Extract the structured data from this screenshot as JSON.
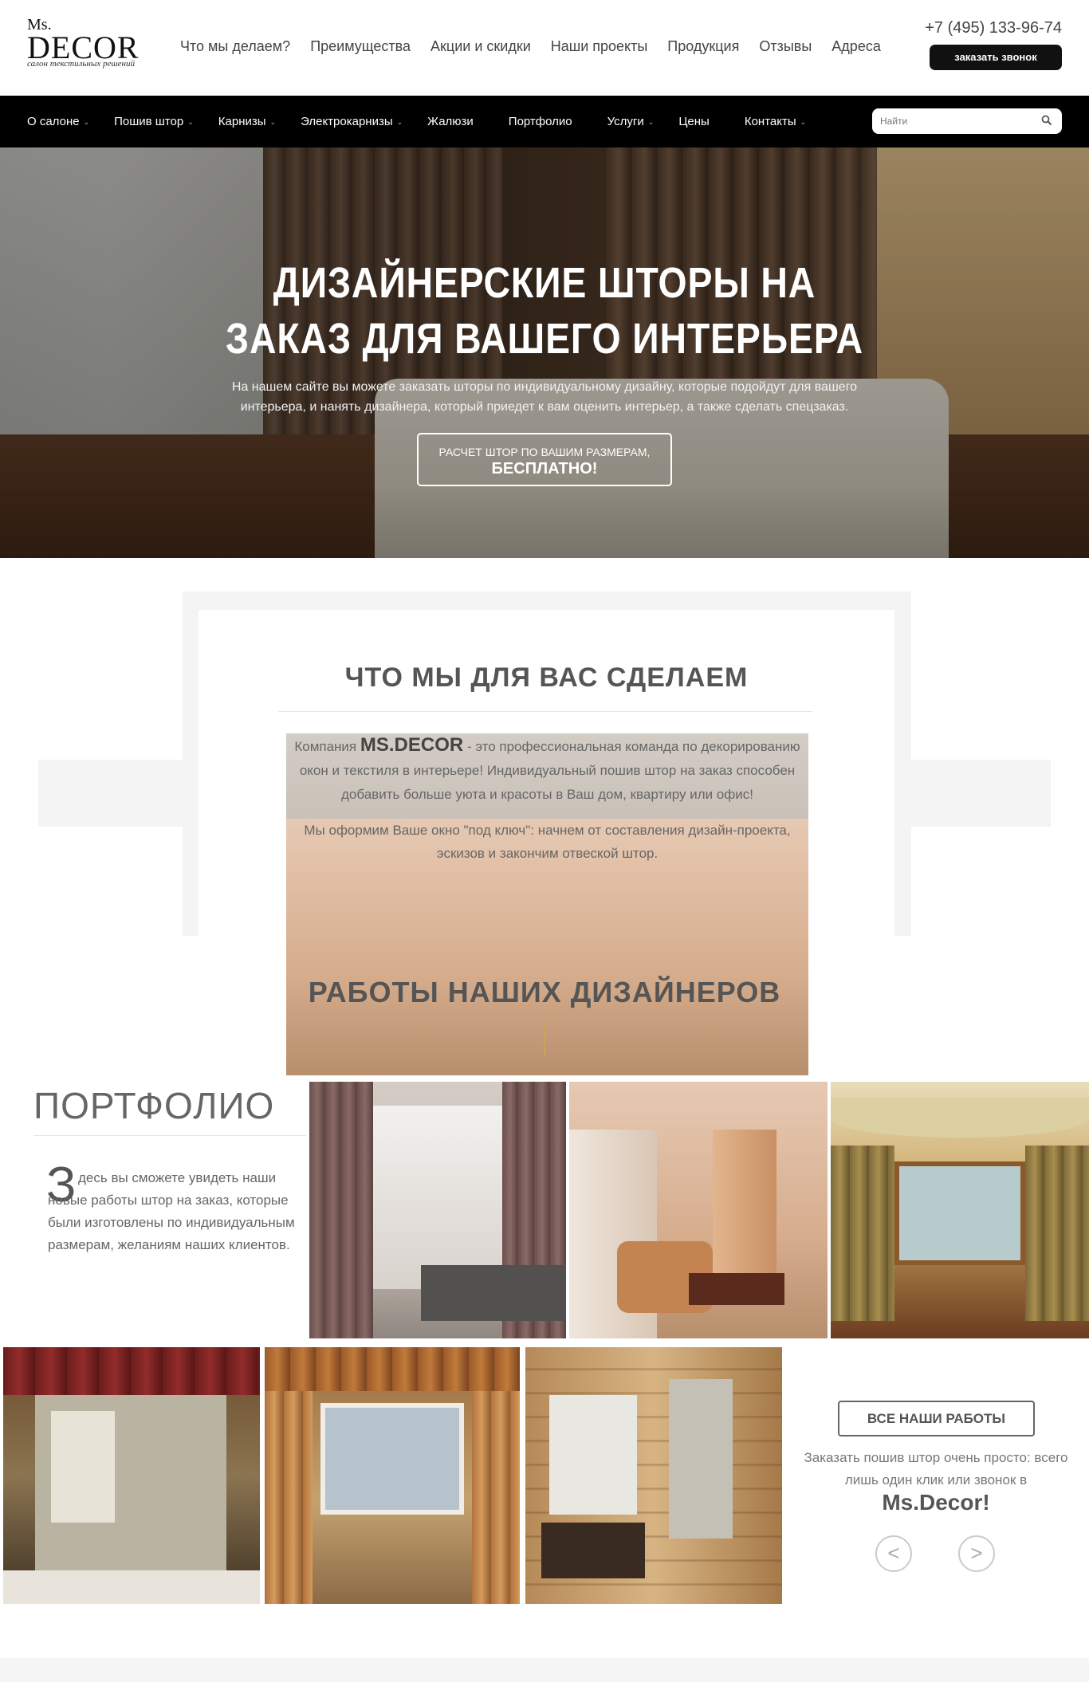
{
  "logo": {
    "ms": "Ms.",
    "decor": "DECOR",
    "tagline": "салон текстильных решений"
  },
  "top_nav": [
    "Что мы делаем?",
    "Преимущества",
    "Акции и скидки",
    "Наши проекты",
    "Продукция",
    "Отзывы",
    "Адреса"
  ],
  "contact": {
    "phone": "+7 (495) 133-96-74",
    "call_button": "заказать звонок"
  },
  "main_nav": [
    {
      "label": "О салоне",
      "dropdown": true
    },
    {
      "label": "Пошив штор",
      "dropdown": true
    },
    {
      "label": "Карнизы",
      "dropdown": true
    },
    {
      "label": "Электрокарнизы",
      "dropdown": true
    },
    {
      "label": "Жалюзи",
      "dropdown": false
    },
    {
      "label": "Портфолио",
      "dropdown": false
    },
    {
      "label": "Услуги",
      "dropdown": true
    },
    {
      "label": "Цены",
      "dropdown": false
    },
    {
      "label": "Контакты",
      "dropdown": true
    }
  ],
  "search": {
    "placeholder": "Найти"
  },
  "hero": {
    "title_line1": "ДИЗАЙНЕРСКИЕ ШТОРЫ НА",
    "title_line2": "ЗАКАЗ ДЛЯ ВАШЕГО ИНТЕРЬЕРА",
    "subtitle": "На нашем сайте вы можете заказать шторы по индивидуальному дизайну, которые подойдут для вашего интерьера, и нанять дизайнера, который приедет к вам оценить интерьер, а также сделать спецзаказ.",
    "cta_line1": "РАСЧЕТ ШТОР ПО ВАШИМ РАЗМЕРАМ,",
    "cta_line2": "БЕСПЛАТНО!"
  },
  "what": {
    "title": "ЧТО МЫ ДЛЯ ВАС СДЕЛАЕМ",
    "p1_prefix": "Компания ",
    "p1_brand": "MS.DECOR",
    "p1_rest": " - это профессиональная команда по декорированию окон и текстиля в интерьере! Индивидуальный пошив штор на заказ способен добавить больше уюта и красоты в Ваш дом, квартиру или офис!",
    "p2": "Мы оформим Ваше окно \"под ключ\": начнем от составления дизайн-проекта, эскизов и закончим отвеской штор."
  },
  "works": {
    "title": "РАБОТЫ НАШИХ ДИЗАЙНЕРОВ",
    "portfolio_title": "ПОРТФОЛИО",
    "dropcap": "З",
    "portfolio_text": "десь вы сможете увидеть наши новые работы штор на заказ, которые были изготовлены по индивидуальным размерам, желаниям наших клиентов.",
    "all_works_button": "ВСЕ НАШИ РАБОТЫ",
    "cta_text": "Заказать пошив штор очень просто: всего лишь один клик или звонок в",
    "cta_brand": "Ms.Decor!",
    "prev": "<",
    "next": ">"
  },
  "colors": {
    "accent_line": "#c9a35a",
    "nav_bg": "#000000"
  }
}
